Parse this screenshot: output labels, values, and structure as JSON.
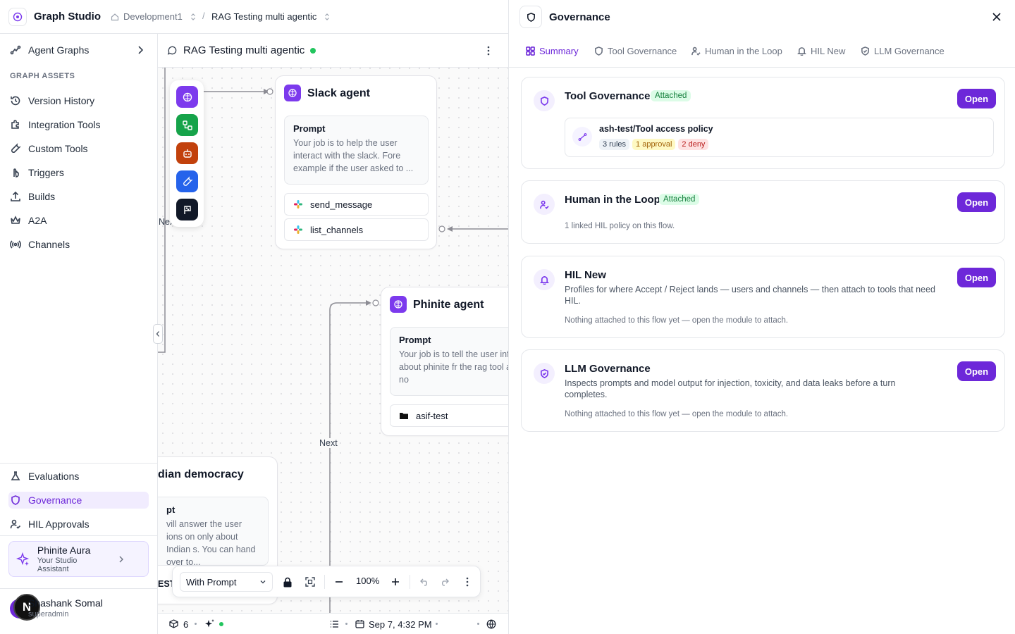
{
  "app": {
    "title": "Graph Studio"
  },
  "breadcrumb": {
    "workspace": "Development1",
    "graph": "RAG Testing multi agentic"
  },
  "sidebar": {
    "top_item": "Agent Graphs",
    "section_label": "GRAPH ASSETS",
    "items": [
      "Version History",
      "Integration Tools",
      "Custom Tools",
      "Triggers",
      "Builds",
      "A2A",
      "Channels"
    ],
    "bottom_items": [
      "Evaluations",
      "Governance",
      "HIL Approvals"
    ],
    "assistant": {
      "name": "Phinite Aura",
      "subtitle": "Your Studio Assistant"
    },
    "user": {
      "name": "Shashank Somal",
      "role": "superadmin",
      "avatar_letter": "N"
    }
  },
  "canvas": {
    "title": "RAG Testing multi agentic",
    "status_color": "#22c55e",
    "nodes": {
      "slack": {
        "title": "Slack agent",
        "prompt_label": "Prompt",
        "prompt_text": "Your job is to help the user interact with the slack. Fore example if the user asked to ...",
        "tools": [
          "send_message",
          "list_channels"
        ]
      },
      "phinite": {
        "title": "Phinite agent",
        "prompt_label": "Prompt",
        "prompt_text": "Your job is to tell the user information about phinite fr the rag tool attached. Do no",
        "tools": [
          "asif-test"
        ]
      },
      "democracy": {
        "title": "dian democracy",
        "prompt_label": "pt",
        "prompt_text": "vill answer the user ions on only about Indian s. You can hand over to..."
      }
    },
    "edge_labels": [
      "Next",
      "Nex",
      "Next"
    ],
    "toolbar": {
      "mode": "With Prompt",
      "zoom": "100%",
      "test_label": "EST"
    }
  },
  "statusbar": {
    "count": "6",
    "datetime": "Sep 7, 4:32 PM"
  },
  "panel": {
    "title": "Governance",
    "tabs": [
      "Summary",
      "Tool Governance",
      "Human in the Loop",
      "HIL New",
      "LLM Governance"
    ],
    "cards": {
      "tool": {
        "title": "Tool Governance",
        "badge": "Attached",
        "open": "Open",
        "policy": {
          "name": "ash-test/Tool access policy",
          "rules": "3 rules",
          "approval": "1 approval",
          "deny": "2 deny"
        }
      },
      "hitl": {
        "title": "Human in the Loop",
        "badge": "Attached",
        "open": "Open",
        "note": "1 linked HIL policy on this flow."
      },
      "hilnew": {
        "title": "HIL New",
        "open": "Open",
        "desc": "Profiles for where Accept / Reject lands — users and channels — then attach to tools that need HIL.",
        "note": "Nothing attached to this flow yet — open the module to attach."
      },
      "llm": {
        "title": "LLM Governance",
        "open": "Open",
        "desc": "Inspects prompts and model output for injection, toxicity, and data leaks before a turn completes.",
        "note": "Nothing attached to this flow yet — open the module to attach."
      }
    }
  },
  "colors": {
    "accent": "#6d28d9",
    "attached_bg": "#dcfce7",
    "attached_text": "#15803d"
  }
}
